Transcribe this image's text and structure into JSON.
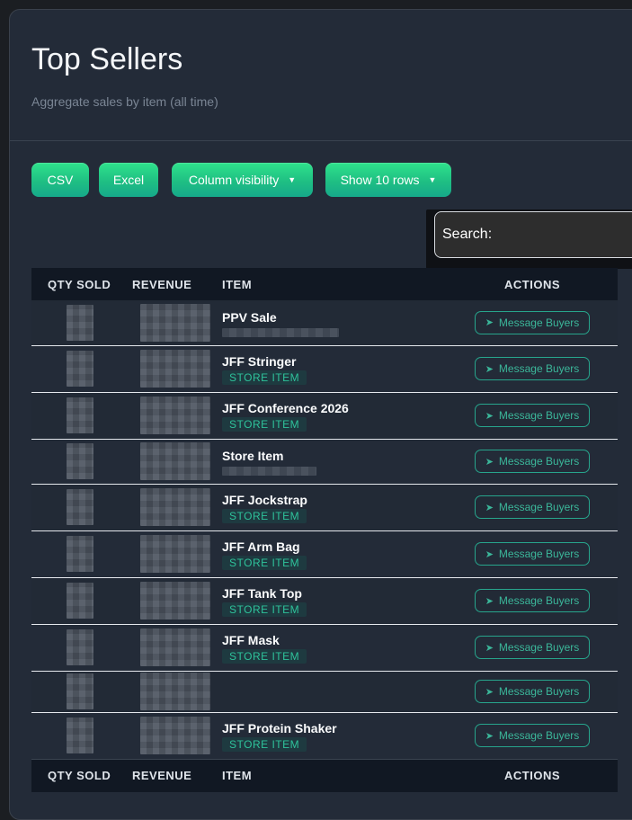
{
  "card": {
    "title": "Top Sellers",
    "subtitle": "Aggregate sales by item (all time)"
  },
  "toolbar": {
    "csv_label": "CSV",
    "excel_label": "Excel",
    "column_visibility_label": "Column visibility",
    "show_rows_label": "Show 10 rows",
    "caret": "▼"
  },
  "search": {
    "label": "Search:"
  },
  "table": {
    "headers": {
      "qty": "QTY SOLD",
      "revenue": "REVENUE",
      "item": "ITEM",
      "actions": "ACTIONS"
    },
    "action_label": "Message Buyers",
    "action_icon": "paper-plane-icon",
    "rows": [
      {
        "item": "PPV Sale",
        "tag": ""
      },
      {
        "item": "JFF Stringer",
        "tag": "STORE ITEM"
      },
      {
        "item": "JFF Conference 2026",
        "tag": "STORE ITEM"
      },
      {
        "item": "Store Item",
        "tag": ""
      },
      {
        "item": "JFF Jockstrap",
        "tag": "STORE ITEM"
      },
      {
        "item": "JFF Arm Bag",
        "tag": "STORE ITEM"
      },
      {
        "item": "JFF Tank Top",
        "tag": "STORE ITEM"
      },
      {
        "item": "JFF Mask",
        "tag": "STORE ITEM"
      },
      {
        "item": "",
        "tag": ""
      },
      {
        "item": "JFF Protein Shaker",
        "tag": "STORE ITEM"
      }
    ]
  },
  "colors": {
    "accent": "#1fbf83",
    "panel": "#232b38",
    "header": "#111823"
  }
}
